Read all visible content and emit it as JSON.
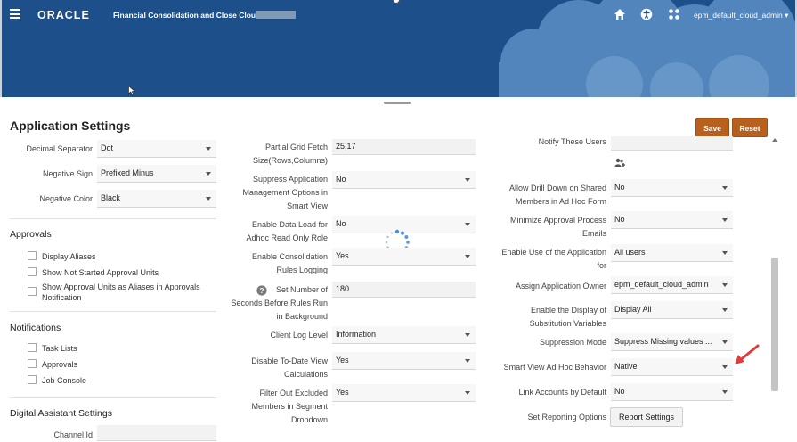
{
  "header": {
    "brand": "ORACLE",
    "app_name": "Financial Consolidation and Close Cloud:",
    "user": "epm_default_cloud_admin ▾",
    "icons": [
      "menu-icon",
      "home-icon",
      "accessibility-icon",
      "navigator-icon"
    ]
  },
  "page": {
    "title": "Application Settings",
    "save_label": "Save",
    "reset_label": "Reset"
  },
  "left": {
    "decimal_separator": {
      "label": "Decimal Separator",
      "value": "Dot"
    },
    "negative_sign": {
      "label": "Negative Sign",
      "value": "Prefixed Minus"
    },
    "negative_color": {
      "label": "Negative Color",
      "value": "Black"
    },
    "approvals": {
      "title": "Approvals",
      "items": [
        "Display Aliases",
        "Show Not Started Approval Units",
        "Show Approval Units as Aliases in Approvals",
        "Notification"
      ]
    },
    "notifications": {
      "title": "Notifications",
      "items": [
        "Task Lists",
        "Approvals",
        "Job Console"
      ]
    },
    "digital_assistant": {
      "title": "Digital Assistant Settings",
      "channel_label": "Channel Id"
    }
  },
  "middle": {
    "grid_fetch": {
      "label1": "Partial Grid Fetch",
      "label2": "Size(Rows,Columns)",
      "value": "25,17"
    },
    "suppress": {
      "label1": "Suppress Application",
      "label2": "Management Options in",
      "label3": "Smart View",
      "value": "No"
    },
    "data_load": {
      "label1": "Enable Data Load for",
      "label2": "Adhoc Read Only Role",
      "value": "No"
    },
    "consolidation": {
      "label1": "Enable Consolidation",
      "label2": "Rules Logging",
      "value": "Yes"
    },
    "seconds": {
      "label1": "Set Number of",
      "label2": "Seconds Before Rules Run",
      "label3": "in Background",
      "value": "180"
    },
    "client_log": {
      "label": "Client Log Level",
      "value": "Information"
    },
    "to_date": {
      "label1": "Disable To-Date View",
      "label2": "Calculations",
      "value": "Yes"
    },
    "filter_out": {
      "label1": "Filter Out Excluded",
      "label2": "Members in Segment",
      "label3": "Dropdown",
      "value": "Yes"
    }
  },
  "right": {
    "notify_users": {
      "label": "Notify These Users"
    },
    "drill_down": {
      "label1": "Allow Drill Down on Shared",
      "label2": "Members in Ad Hoc Form",
      "value": "No"
    },
    "minimize": {
      "label1": "Minimize Approval Process",
      "label2": "Emails",
      "value": "No"
    },
    "enable_use": {
      "label1": "Enable Use of the Application",
      "label2": "for",
      "value": "All users"
    },
    "owner": {
      "label": "Assign Application Owner",
      "value": "epm_default_cloud_admin"
    },
    "substitution": {
      "label1": "Enable the Display of",
      "label2": "Substitution Variables",
      "value": "Display All"
    },
    "suppression": {
      "label": "Suppression Mode",
      "value": "Suppress Missing values ..."
    },
    "adhoc": {
      "label": "Smart View Ad Hoc Behavior",
      "value": "Native"
    },
    "link_accounts": {
      "label": "Link Accounts by Default",
      "value": "No"
    },
    "reporting": {
      "label": "Set Reporting Options",
      "button": "Report Settings"
    }
  },
  "colors": {
    "header_bg": "#1d4f8a",
    "cloud": "#5b8fc5",
    "accent_button": "#b8611f",
    "annotation_arrow": "#e23b3b",
    "spinner": "#4a8fd4"
  }
}
